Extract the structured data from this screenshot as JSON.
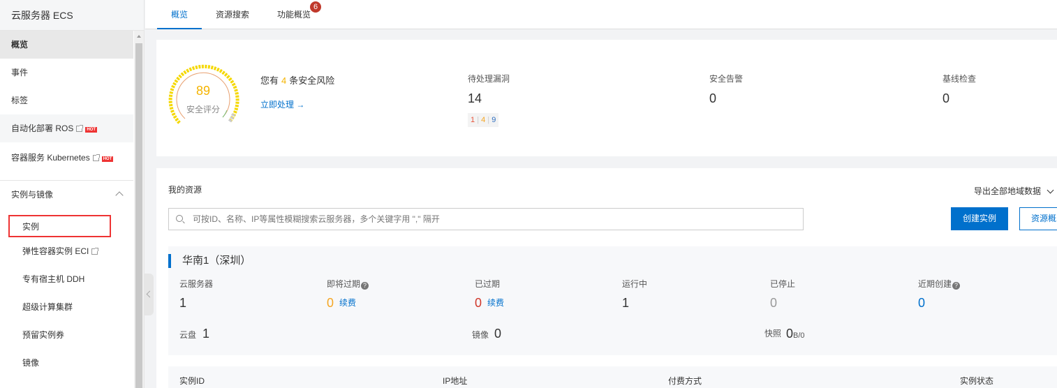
{
  "sidebar": {
    "title": "云服务器 ECS",
    "items": [
      {
        "label": "概览"
      },
      {
        "label": "事件"
      },
      {
        "label": "标签"
      },
      {
        "label": "自动化部署 ROS",
        "hot": "HOT"
      },
      {
        "label": "容器服务 Kubernetes",
        "hot": "HOT"
      }
    ],
    "group": {
      "label": "实例与镜像",
      "items": [
        {
          "label": "实例"
        },
        {
          "label": "弹性容器实例 ECI"
        },
        {
          "label": "专有宿主机 DDH"
        },
        {
          "label": "超级计算集群"
        },
        {
          "label": "预留实例券"
        },
        {
          "label": "镜像"
        }
      ]
    }
  },
  "tabs": [
    {
      "label": "概览"
    },
    {
      "label": "资源搜索"
    },
    {
      "label": "功能概览",
      "badge": "6"
    }
  ],
  "security": {
    "score": "89",
    "score_label": "安全评分",
    "risk_prefix": "您有",
    "risk_count": "4",
    "risk_suffix": "条安全风险",
    "action_link": "立即处理 →",
    "stats": [
      {
        "label": "待处理漏洞",
        "value": "14"
      },
      {
        "label": "安全告警",
        "value": "0"
      },
      {
        "label": "基线检查",
        "value": "0"
      }
    ],
    "vuln_breakdown": {
      "high": "1",
      "medium": "4",
      "low": "9",
      "sep": "|"
    }
  },
  "resources": {
    "title": "我的资源",
    "export_label": "导出全部地域数据",
    "search_placeholder": "可按ID、名称、IP等属性模糊搜索云服务器，多个关键字用 \",\" 隔开",
    "create_button": "创建实例",
    "overview_button": "资源概览",
    "region": {
      "name": "华南1（深圳）",
      "stats": [
        {
          "label": "云服务器",
          "value": "1"
        },
        {
          "label": "即将过期",
          "value": "0",
          "action": "续费",
          "help": "?"
        },
        {
          "label": "已过期",
          "value": "0",
          "action": "续费"
        },
        {
          "label": "运行中",
          "value": "1"
        },
        {
          "label": "已停止",
          "value": "0"
        },
        {
          "label": "近期创建",
          "value": "0",
          "help": "?"
        }
      ],
      "storage": [
        {
          "label": "云盘",
          "value": "1"
        },
        {
          "label": "镜像",
          "value": "0"
        },
        {
          "label": "快照",
          "value": "0",
          "unit": "B/0"
        }
      ]
    },
    "table_columns": [
      "实例ID",
      "IP地址",
      "付费方式",
      "实例状态"
    ]
  },
  "colors": {
    "accent": "#0070cc",
    "badge": "#c0392b",
    "score": "#f5b400",
    "highlight_box": "#ee3333"
  }
}
